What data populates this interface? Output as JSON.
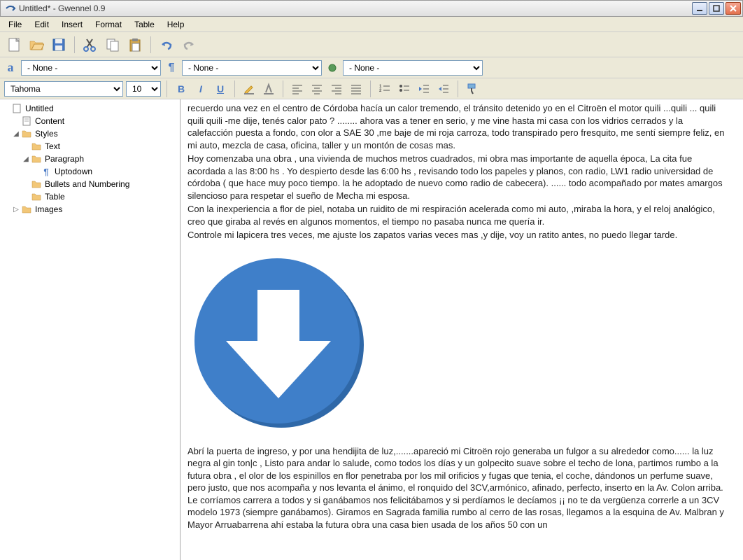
{
  "window": {
    "title": "Untitled* - Gwennel 0.9"
  },
  "menu": {
    "file": "File",
    "edit": "Edit",
    "insert": "Insert",
    "format": "Format",
    "table": "Table",
    "help": "Help"
  },
  "style_bar": {
    "char_style": "- None -",
    "para_style": "- None -",
    "list_style": "- None -"
  },
  "format_bar": {
    "font": "Tahoma",
    "size": "10"
  },
  "tree": {
    "root": "Untitled",
    "content": "Content",
    "styles": "Styles",
    "text": "Text",
    "paragraph": "Paragraph",
    "uptodown": "Uptodown",
    "bullets": "Bullets and Numbering",
    "table": "Table",
    "images": "Images"
  },
  "document": {
    "p1": "recuerdo una vez en el centro de Córdoba hacía un calor tremendo, el tránsito detenido yo en el Citroën el motor quili ...quili ... quili quili quili -me dije, tenés calor pato ? ........ ahora vas a tener en serio, y me vine hasta mi casa con los vidrios cerrados y la calefacción puesta a fondo, con olor a SAE 30 ,me baje de mi roja carroza, todo transpirado pero fresquito, me sentí siempre feliz, en mi auto, mezcla de casa, oficina, taller y un montón de cosas mas.",
    "p2": "Hoy comenzaba una obra , una vivienda de muchos metros cuadrados, mi obra mas importante de aquella época, La cita fue acordada a las 8:00 hs . Yo despierto desde las 6:00 hs , revisando todo los papeles y planos, con radio, LW1 radio universidad de córdoba ( que hace muy poco tiempo. la he adoptado de nuevo como radio de cabecera). ...... todo acompañado por mates amargos silencioso para respetar el sueño de Mecha mi esposa.",
    "p3": "Con la inexperiencia a flor de piel, notaba un ruidito de mi respiración acelerada como mi auto, ,miraba la hora, y el reloj analógico, creo que giraba al revés en algunos momentos, el tiempo no pasaba nunca me quería ir.",
    "p4": "Controle mi lapicera tres veces, me ajuste los zapatos varias veces mas ,y dije, voy un ratito antes, no puedo llegar tarde.",
    "p5": "Abrí la puerta de ingreso, y por una hendijita de luz,.......apareció mi Citroën rojo generaba un fulgor a su alrededor como...... la luz negra al gin ton|c , Listo para andar lo salude, como todos los días y un golpecito suave sobre el techo de lona, partimos rumbo a la futura obra , el olor de los espinillos en flor penetraba por los mil orificios y fugas que tenia, el coche, dándonos un perfume suave, pero justo, que nos acompaña y nos levanta el ánimo, el ronquido del 3CV,armónico, afinado, perfecto, inserto en la Av. Colon arriba. Le corríamos carrera a todos y si ganábamos nos felicitábamos y si perdíamos le decíamos ¡¡ no te da vergüenza correrle a un 3CV modelo 1973 (siempre ganábamos). Giramos en Sagrada familia rumbo al cerro de las rosas, llegamos a la esquina de Av. Malbran y Mayor Arruabarrena ahí estaba la futura obra una casa bien usada de los años 50 con un"
  }
}
